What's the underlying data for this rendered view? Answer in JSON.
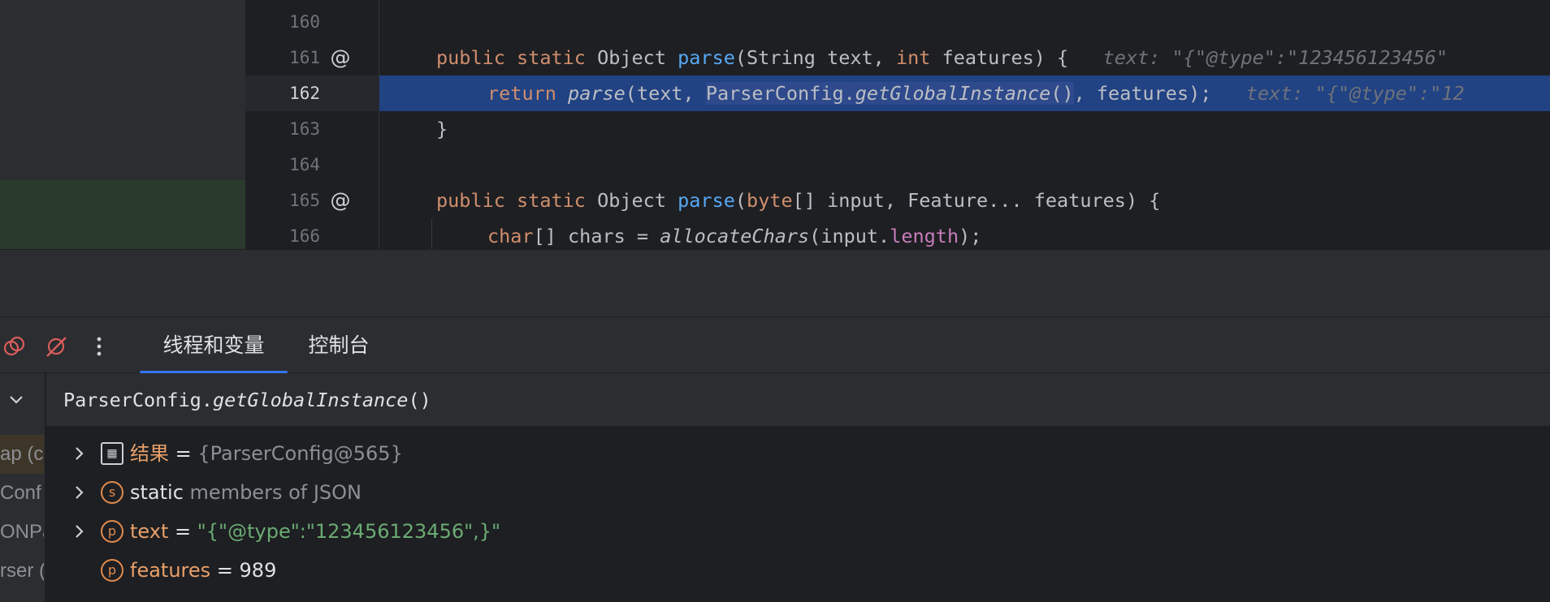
{
  "editor": {
    "lines": [
      {
        "num": "160",
        "tokens": []
      },
      {
        "num": "161",
        "gutter_icon": "@",
        "tokens": [
          [
            "kw",
            "public "
          ],
          [
            "kw",
            "static "
          ],
          [
            "plain",
            "Object "
          ],
          [
            "fn",
            "parse"
          ],
          [
            "plain",
            "(String text, "
          ],
          [
            "kw",
            "int "
          ],
          [
            "plain",
            "features) {"
          ],
          [
            "hint",
            "   text: \"{\"@type\":\"123456123456\""
          ]
        ]
      },
      {
        "num": "162",
        "current": true,
        "tokens": [
          [
            "kw",
            "return "
          ],
          [
            "it",
            "parse"
          ],
          [
            "plain",
            "(text, "
          ],
          [
            "sel",
            "ParserConfig."
          ],
          [
            "sel-it",
            "getGlobalInstance"
          ],
          [
            "sel",
            "()"
          ],
          [
            "plain",
            ", features);"
          ],
          [
            "hint",
            "   text: \"{\"@type\":\"12"
          ]
        ]
      },
      {
        "num": "163",
        "tokens": [
          [
            "plain",
            "}"
          ]
        ]
      },
      {
        "num": "164",
        "tokens": []
      },
      {
        "num": "165",
        "gutter_icon": "@",
        "tokens": [
          [
            "kw",
            "public "
          ],
          [
            "kw",
            "static "
          ],
          [
            "plain",
            "Object "
          ],
          [
            "fn",
            "parse"
          ],
          [
            "plain",
            "("
          ],
          [
            "kw",
            "byte"
          ],
          [
            "plain",
            "[] input, Feature... features) {"
          ]
        ]
      },
      {
        "num": "166",
        "tokens": [
          [
            "kw",
            "char"
          ],
          [
            "plain",
            "[] chars = "
          ],
          [
            "it",
            "allocateChars"
          ],
          [
            "plain",
            "(input."
          ],
          [
            "field",
            "length"
          ],
          [
            "plain",
            ");"
          ]
        ]
      }
    ]
  },
  "debug": {
    "tabs": [
      {
        "label": "线程和变量",
        "active": true
      },
      {
        "label": "控制台",
        "active": false
      }
    ],
    "expression": {
      "prefix": "ParserConfig.",
      "method": "getGlobalInstance",
      "suffix": "()"
    },
    "frames": [
      "ap (c",
      "Conf",
      "ONPa",
      "rser ("
    ],
    "variables": [
      {
        "icon": "calculator-icon",
        "icon_glyph": "▦",
        "name": "结果",
        "eq": " = ",
        "value": "{ParserConfig@565}",
        "value_style": "gray",
        "expandable": true
      },
      {
        "icon": "static-icon",
        "icon_glyph": "s",
        "name": "static",
        "eq": " ",
        "value": "members of JSON",
        "value_style": "gray",
        "name_style": "plain",
        "expandable": true
      },
      {
        "icon": "parameter-icon",
        "icon_glyph": "p",
        "name": "text",
        "eq": " = ",
        "value": "\"{\"@type\":\"123456123456\",}\"",
        "value_style": "string",
        "expandable": true
      },
      {
        "icon": "parameter-icon",
        "icon_glyph": "p",
        "name": "features",
        "eq": " = ",
        "value": "989",
        "value_style": "plain",
        "expandable": false
      }
    ]
  },
  "colors": {
    "accent": "#3574f0",
    "keyword": "#cf8e6d",
    "function": "#56a8f5",
    "string": "#6aab73",
    "selection": "#2e4a8c"
  }
}
